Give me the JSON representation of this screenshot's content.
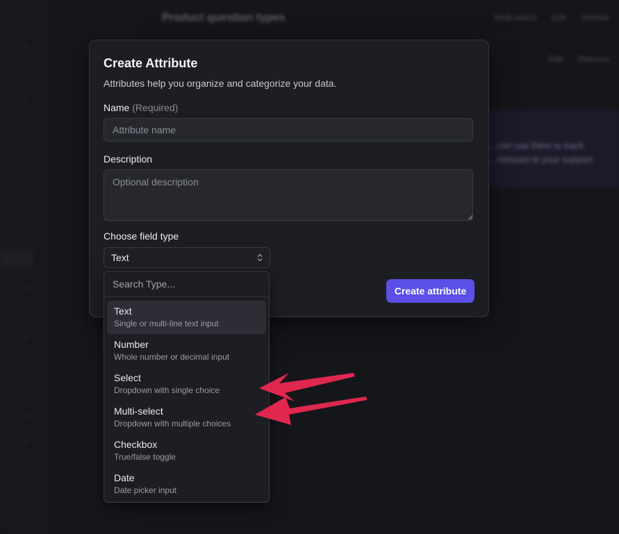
{
  "background": {
    "page_title": "Product question types",
    "header_actions": [
      "Multi-select",
      "Edit",
      "Archive"
    ],
    "row_actions": [
      "Edit",
      "Remove"
    ],
    "info_text": [
      "...can use them to track",
      "...relevant to your support"
    ]
  },
  "modal": {
    "title": "Create Attribute",
    "subtitle": "Attributes help you organize and categorize your data.",
    "name_label": "Name",
    "name_required": "(Required)",
    "name_placeholder": "Attribute name",
    "description_label": "Description",
    "description_placeholder": "Optional description",
    "field_type_label": "Choose field type",
    "field_type_value": "Text",
    "submit_label": "Create attribute"
  },
  "dropdown": {
    "search_placeholder": "Search Type...",
    "options": [
      {
        "label": "Text",
        "description": "Single or multi-line text input",
        "highlighted": true
      },
      {
        "label": "Number",
        "description": "Whole number or decimal input"
      },
      {
        "label": "Select",
        "description": "Dropdown with single choice"
      },
      {
        "label": "Multi-select",
        "description": "Dropdown with multiple choices"
      },
      {
        "label": "Checkbox",
        "description": "True/false toggle"
      },
      {
        "label": "Date",
        "description": "Date picker input"
      }
    ]
  },
  "colors": {
    "accent": "#5b4fe8",
    "annotation_arrow": "#e0284f",
    "modal_bg": "#1d1e23",
    "page_bg": "#15161a"
  },
  "icons": {
    "select_chevron": "chevron-up-down-icon",
    "annotation": "red-arrow-icon"
  }
}
